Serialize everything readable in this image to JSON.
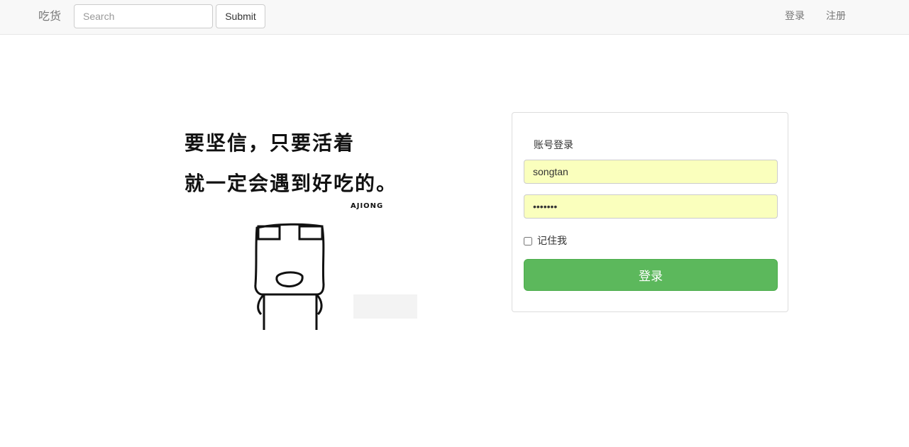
{
  "navbar": {
    "brand": "吃货",
    "search": {
      "placeholder": "Search",
      "value": ""
    },
    "submit_label": "Submit",
    "links": {
      "login": "登录",
      "register": "注册"
    }
  },
  "illustration": {
    "line1": "要坚信，只要活着",
    "line2": "就一定会遇到好吃的。",
    "credit": "AJIONG"
  },
  "login_form": {
    "title": "账号登录",
    "username_value": "songtan",
    "password_value": "songtan",
    "remember_label": "记住我",
    "remember_checked": false,
    "submit_label": "登录"
  },
  "colors": {
    "navbar_bg": "#f8f8f8",
    "autofill_bg": "#faffbd",
    "success_green": "#5cb85c"
  }
}
